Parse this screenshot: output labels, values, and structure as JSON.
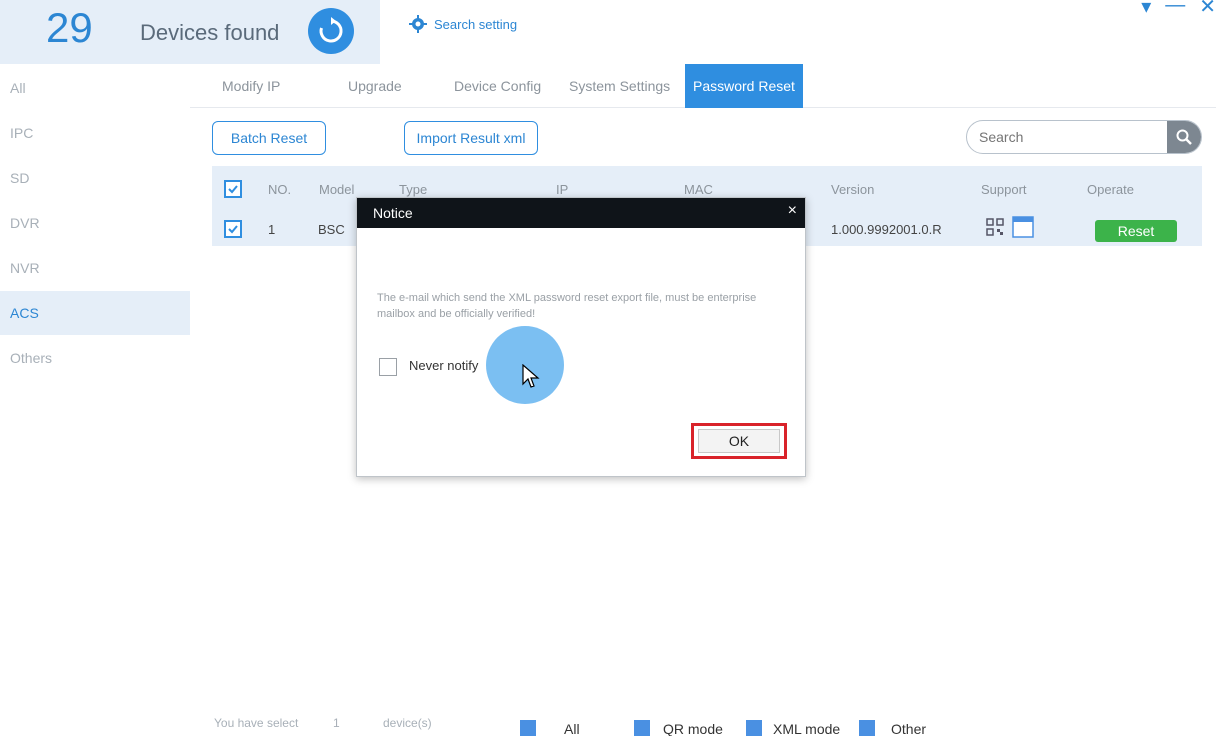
{
  "header": {
    "device_count": "29",
    "found_label": "Devices found",
    "search_setting": "Search setting"
  },
  "sidebar": {
    "items": [
      {
        "label": "All"
      },
      {
        "label": "IPC"
      },
      {
        "label": "SD"
      },
      {
        "label": "DVR"
      },
      {
        "label": "NVR"
      },
      {
        "label": "ACS"
      },
      {
        "label": "Others"
      }
    ],
    "active": "ACS"
  },
  "tabs": [
    {
      "label": "Modify IP"
    },
    {
      "label": "Upgrade"
    },
    {
      "label": "Device Config"
    },
    {
      "label": "System Settings"
    },
    {
      "label": "Password Reset"
    }
  ],
  "toolbar": {
    "batch_reset": "Batch Reset",
    "import_result": "Import Result xml",
    "search_placeholder": "Search"
  },
  "table": {
    "headers": {
      "no": "NO.",
      "model": "Model",
      "type": "Type",
      "ip": "IP",
      "mac": "MAC",
      "version": "Version",
      "support": "Support",
      "operate": "Operate"
    },
    "rows": [
      {
        "no": "1",
        "model": "BSC",
        "version": "1.000.9992001.0.R",
        "action": "Reset"
      }
    ]
  },
  "dialog": {
    "title": "Notice",
    "close": "×",
    "message": "The e-mail which send the XML password reset export file, must be enterprise mailbox and be officially verified!",
    "never_notify": "Never notify",
    "ok": "OK"
  },
  "footer": {
    "select_prefix": "You have select",
    "select_count": "1",
    "select_suffix": "device(s)",
    "legend": [
      {
        "label": "All"
      },
      {
        "label": "QR mode"
      },
      {
        "label": "XML mode"
      },
      {
        "label": "Other"
      }
    ]
  },
  "colors": {
    "accent": "#2f8ee0",
    "active_bg": "#e5eef8",
    "success": "#3cb34a",
    "highlight": "#d9232a"
  }
}
